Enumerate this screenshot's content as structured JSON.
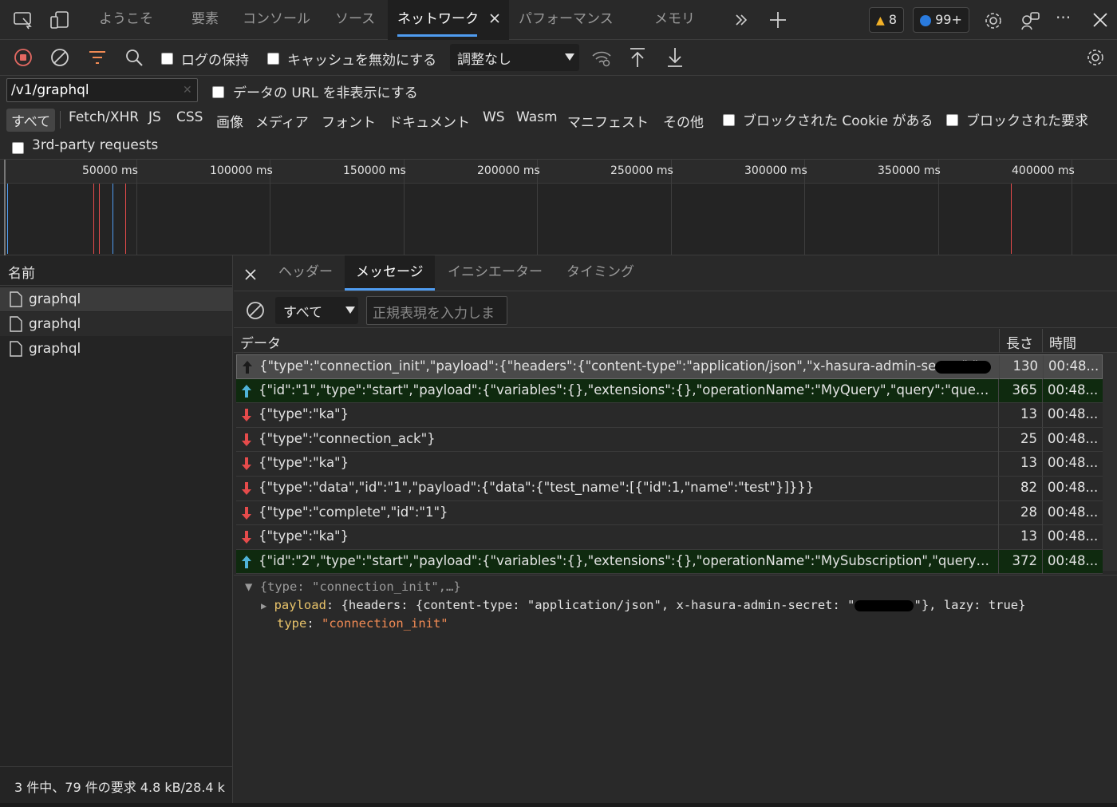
{
  "tabs": {
    "welcome": "ようこそ",
    "elements": "要素",
    "console": "コンソール",
    "sources": "ソース",
    "network": "ネットワーク",
    "performance": "パフォーマンス",
    "memory": "メモリ",
    "warnings_count": "8",
    "issues_count": "99+"
  },
  "toolbar": {
    "preserve_log": "ログの保持",
    "disable_cache": "キャッシュを無効にする",
    "throttling": "調整なし"
  },
  "filter": {
    "url_value": "/v1/graphql",
    "hide_data_urls": "データの URL を非表示にする",
    "types": [
      "すべて",
      "Fetch/XHR",
      "JS",
      "CSS",
      "画像",
      "メディア",
      "フォント",
      "ドキュメント",
      "WS",
      "Wasm",
      "マニフェスト",
      "その他"
    ],
    "blocked_cookies": "ブロックされた Cookie がある",
    "blocked_requests": "ブロックされた要求",
    "third_party": "3rd-party requests"
  },
  "timeline": {
    "ticks": [
      "50000 ms",
      "100000 ms",
      "150000 ms",
      "200000 ms",
      "250000 ms",
      "300000 ms",
      "350000 ms",
      "400000 ms"
    ]
  },
  "left": {
    "header": "名前",
    "requests": [
      "graphql",
      "graphql",
      "graphql"
    ],
    "status": "3 件中、79 件の要求 4.8 kB/28.4 k"
  },
  "detail_tabs": {
    "headers": "ヘッダー",
    "messages": "メッセージ",
    "initiator": "イニシエーター",
    "timing": "タイミング"
  },
  "msgfilter": {
    "select": "すべて",
    "placeholder": "正規表現を入力しま"
  },
  "msgtable": {
    "col_data": "データ",
    "col_length": "長さ",
    "col_time": "時間",
    "rows": [
      {
        "dir": "up",
        "data": "{\"type\":\"connection_init\",\"payload\":{\"headers\":{\"content-type\":\"application/json\",\"x-hasura-admin-secret\":\"",
        "length": "130",
        "time": "00:48..."
      },
      {
        "dir": "up",
        "data": "{\"id\":\"1\",\"type\":\"start\",\"payload\":{\"variables\":{},\"extensions\":{},\"operationName\":\"MyQuery\",\"query\":\"query MyQue...",
        "length": "365",
        "time": "00:48..."
      },
      {
        "dir": "down",
        "data": "{\"type\":\"ka\"}",
        "length": "13",
        "time": "00:48..."
      },
      {
        "dir": "down",
        "data": "{\"type\":\"connection_ack\"}",
        "length": "25",
        "time": "00:48..."
      },
      {
        "dir": "down",
        "data": "{\"type\":\"ka\"}",
        "length": "13",
        "time": "00:48..."
      },
      {
        "dir": "down",
        "data": "{\"type\":\"data\",\"id\":\"1\",\"payload\":{\"data\":{\"test_name\":[{\"id\":1,\"name\":\"test\"}]}}}",
        "length": "82",
        "time": "00:48..."
      },
      {
        "dir": "down",
        "data": "{\"type\":\"complete\",\"id\":\"1\"}",
        "length": "28",
        "time": "00:48..."
      },
      {
        "dir": "down",
        "data": "{\"type\":\"ka\"}",
        "length": "13",
        "time": "00:48..."
      },
      {
        "dir": "up",
        "data": "{\"id\":\"2\",\"type\":\"start\",\"payload\":{\"variables\":{},\"extensions\":{},\"operationName\":\"MySubscription\",\"query\":\"query ...",
        "length": "372",
        "time": "00:48..."
      }
    ]
  },
  "detail": {
    "summary": "{type: \"connection_init\",…}",
    "payload_key": "payload",
    "payload_open": "{headers: {content-type: \"application/json\", x-hasura-admin-secret: \"",
    "payload_close": "\"}, lazy: true}",
    "type_key": "type",
    "type_value": "\"connection_init\""
  },
  "colors": {
    "accent": "#4f9cf0",
    "record": "#e46962",
    "sent_row": "#0f2a0f",
    "up_arrow": "#4fb3d9",
    "down_arrow": "#e54b4b"
  }
}
